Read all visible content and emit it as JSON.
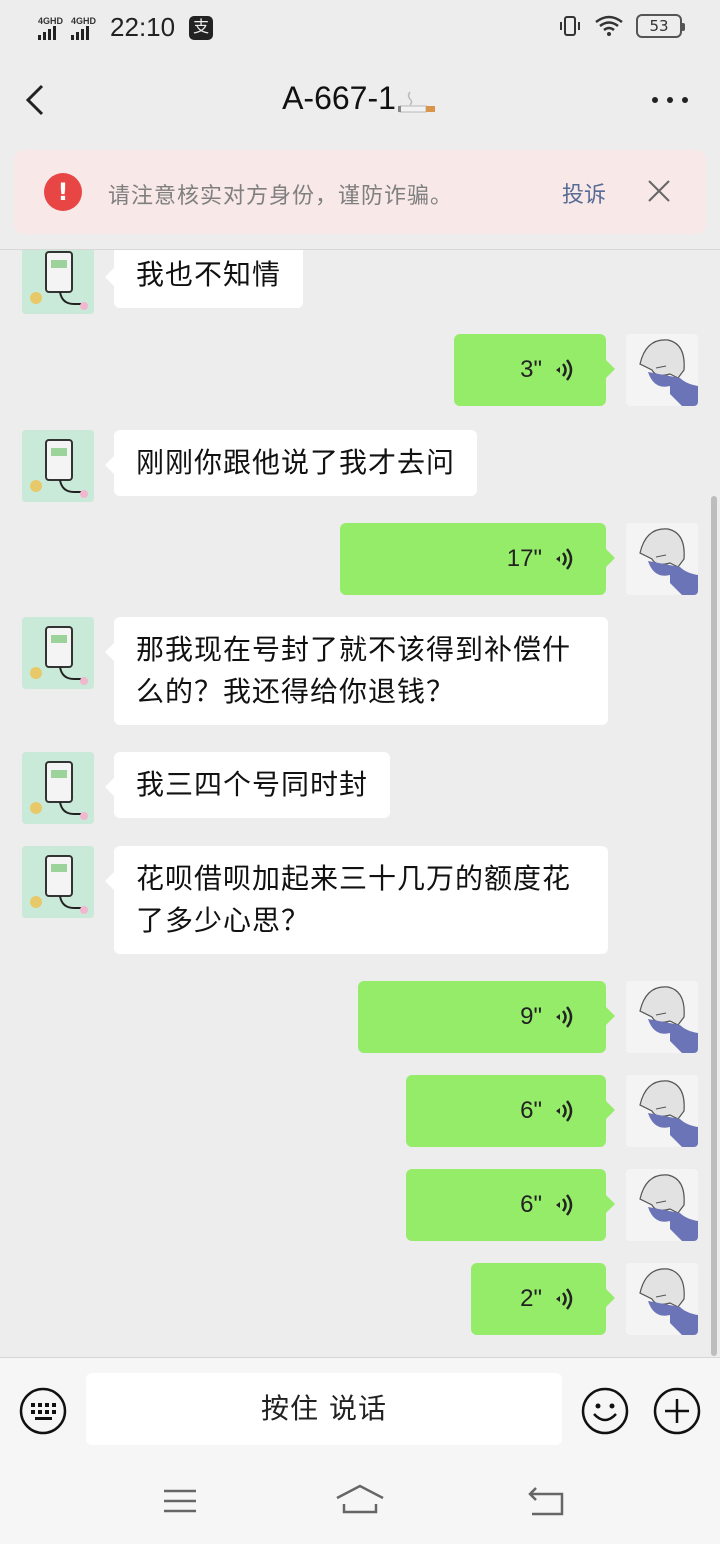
{
  "status_bar": {
    "signal_1": "4GHD",
    "signal_2": "4GHD",
    "time": "22:10",
    "app_icon": "支",
    "battery": "53",
    "icons": [
      "vibrate-icon",
      "wifi-icon",
      "battery-icon"
    ]
  },
  "header": {
    "title": "A-667-1",
    "title_icon": "cigarette-icon",
    "back_icon": "back-arrow-icon",
    "more_icon": "more-dots-icon"
  },
  "warning": {
    "icon": "!",
    "text": "请注意核实对方身份，谨防诈骗。",
    "report_label": "投诉",
    "close_icon": "close-icon"
  },
  "messages": [
    {
      "from": "them",
      "type": "text",
      "text": "我也不知情"
    },
    {
      "from": "me",
      "type": "voice",
      "duration": "3\""
    },
    {
      "from": "them",
      "type": "text",
      "text": "刚刚你跟他说了我才去问"
    },
    {
      "from": "me",
      "type": "voice",
      "duration": "17\""
    },
    {
      "from": "them",
      "type": "text",
      "lines": [
        "那我现在号封了就不该得到补偿什",
        "么的？我还得给你退钱？"
      ]
    },
    {
      "from": "them",
      "type": "text",
      "text": "我三四个号同时封"
    },
    {
      "from": "them",
      "type": "text",
      "lines": [
        "花呗借呗加起来三十几万的额度花",
        "了多少心思？"
      ]
    },
    {
      "from": "me",
      "type": "voice",
      "duration": "9\""
    },
    {
      "from": "me",
      "type": "voice",
      "duration": "6\""
    },
    {
      "from": "me",
      "type": "voice",
      "duration": "6\""
    },
    {
      "from": "me",
      "type": "voice",
      "duration": "2\""
    }
  ],
  "input_bar": {
    "hold_to_talk": "按住 说话",
    "keyboard_icon": "keyboard-icon",
    "emoji_icon": "emoji-icon",
    "plus_icon": "plus-icon"
  },
  "system_nav": {
    "icons": [
      "menu-icon",
      "home-icon",
      "back-icon"
    ]
  },
  "colors": {
    "background": "#ededed",
    "outgoing_bubble": "#95ec69",
    "incoming_bubble": "#ffffff",
    "warning_bg": "#f8e8e7",
    "warning_icon": "#e84545",
    "link": "#576b95"
  }
}
